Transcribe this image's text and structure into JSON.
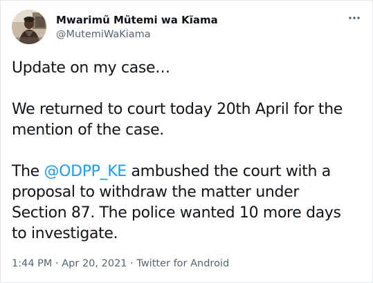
{
  "author": {
    "display_name": "Mwarimũ Mũtemi wa Kĩama",
    "handle": "@MutemiWaKiama",
    "avatar_icon": "profile-photo"
  },
  "more_icon": "more-horizontal-icon",
  "tweet": {
    "line_1": "Update on my case…",
    "line_2": "We returned to court today 20th April for the",
    "line_3": "mention of the case.",
    "line_4_prefix": "The ",
    "mention": "@ODPP_KE",
    "line_4_suffix": " ambushed the court with a",
    "line_5": "proposal to withdraw the matter under",
    "line_6": "Section 87. The police wanted 10 more days",
    "line_7": "to investigate."
  },
  "meta": {
    "time": "1:44 PM",
    "separator": " · ",
    "date": "Apr 20, 2021",
    "source": "Twitter for Android"
  },
  "colors": {
    "link": "#1d9bf0",
    "text": "#0f1419",
    "secondary": "#536471"
  }
}
